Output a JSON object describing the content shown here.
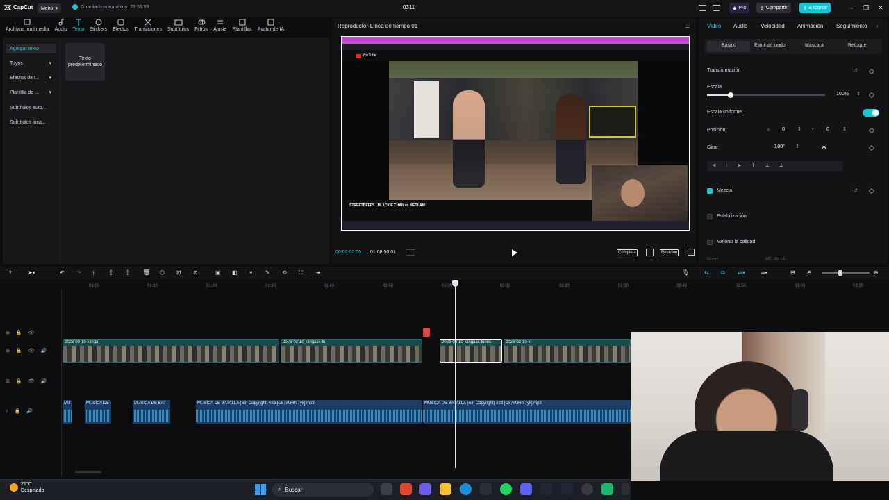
{
  "app": {
    "logo_text": "CapCut",
    "menu_label": "Menú",
    "autosave": "Guardado automático: 23:56:38",
    "project_title": "0311",
    "pro_label": "Pro",
    "share_label": "Compartir",
    "export_label": "Exportar",
    "accent_color": "#20c4d8"
  },
  "toolbar": {
    "items": [
      {
        "label": "Archivos multimedia",
        "icon": "media-icon"
      },
      {
        "label": "Audio",
        "icon": "audio-icon"
      },
      {
        "label": "Texto",
        "icon": "text-icon",
        "active": true
      },
      {
        "label": "Stickers",
        "icon": "sticker-icon"
      },
      {
        "label": "Efectos",
        "icon": "effects-icon"
      },
      {
        "label": "Transiciones",
        "icon": "transition-icon"
      },
      {
        "label": "Subtítulos",
        "icon": "subtitles-icon"
      },
      {
        "label": "Filtros",
        "icon": "filter-icon"
      },
      {
        "label": "Ajuste",
        "icon": "adjust-icon"
      },
      {
        "label": "Plantillas",
        "icon": "template-icon"
      },
      {
        "label": "Avatar de IA",
        "icon": "avatar-icon"
      }
    ]
  },
  "left_nav": {
    "items": [
      {
        "label": "Agregar texto",
        "active": true
      },
      {
        "label": "Tuyos"
      },
      {
        "label": "Efectos de t..."
      },
      {
        "label": "Plantilla de ..."
      },
      {
        "label": "Subtítulos auto..."
      },
      {
        "label": "Subtítulos loca..."
      }
    ],
    "template_card": "Texto predeterminado"
  },
  "player": {
    "title": "Reproductor-Línea de tiempo 01",
    "current_time": "00:02:02:05",
    "total_time": "01:08:50:01",
    "btn_full": "Completa",
    "btn_ratio": "Relación",
    "video_caption": "STREETBEEFS | BLACKIE CHAN vs METHAM",
    "yt_label": "YouTube"
  },
  "properties": {
    "tabs": [
      "Video",
      "Audio",
      "Velocidad",
      "Animación",
      "Seguimiento"
    ],
    "subtabs": [
      "Básico",
      "Eliminar fondo",
      "Máscara",
      "Retoque"
    ],
    "transform_label": "Transformación",
    "scale_label": "Escala",
    "scale_value": "100%",
    "scale_level": 0.2,
    "uniform_label": "Escala uniforme",
    "position_label": "Posición",
    "pos_x_label": "X",
    "pos_x": "0",
    "pos_y_label": "Y",
    "pos_y": "0",
    "rotate_label": "Girar",
    "rotate_value": "0.00°",
    "blend_label": "Mezcla",
    "stabilize_label": "Estabilización",
    "enhance_label": "Mejorar la calidad",
    "level_label": "Nivel",
    "level_value": "HD de IA"
  },
  "timeline": {
    "ruler": [
      "01:00",
      "01:10",
      "01:20",
      "01:30",
      "01:40",
      "01:50",
      "02:00",
      "02:10",
      "02:20",
      "02:30",
      "02:40",
      "02:50",
      "03:00",
      "03:10"
    ],
    "video_clips": [
      {
        "label": "2026-03-10-klinga"
      },
      {
        "label": "2026-03-10-klingaax-lu"
      },
      {
        "label": "2026-03-10-klingaax-lunes",
        "selected": true
      },
      {
        "label": "2026-03-10-kl"
      }
    ],
    "audio_clips": [
      {
        "label": "MU"
      },
      {
        "label": "MUSICA DE"
      },
      {
        "label": "MUSICA DE BAT"
      },
      {
        "label": "MUSICA DE BATALLA (Sin Copyright) #23 [C87eURhI7yk].mp3"
      },
      {
        "label": "MUSICA DE BATALLA (Sin Copyright) #23 [C87eURhI7yk].mp3"
      }
    ]
  },
  "taskbar": {
    "temp": "21°C",
    "weather": "Despejado",
    "search_placeholder": "Buscar"
  }
}
